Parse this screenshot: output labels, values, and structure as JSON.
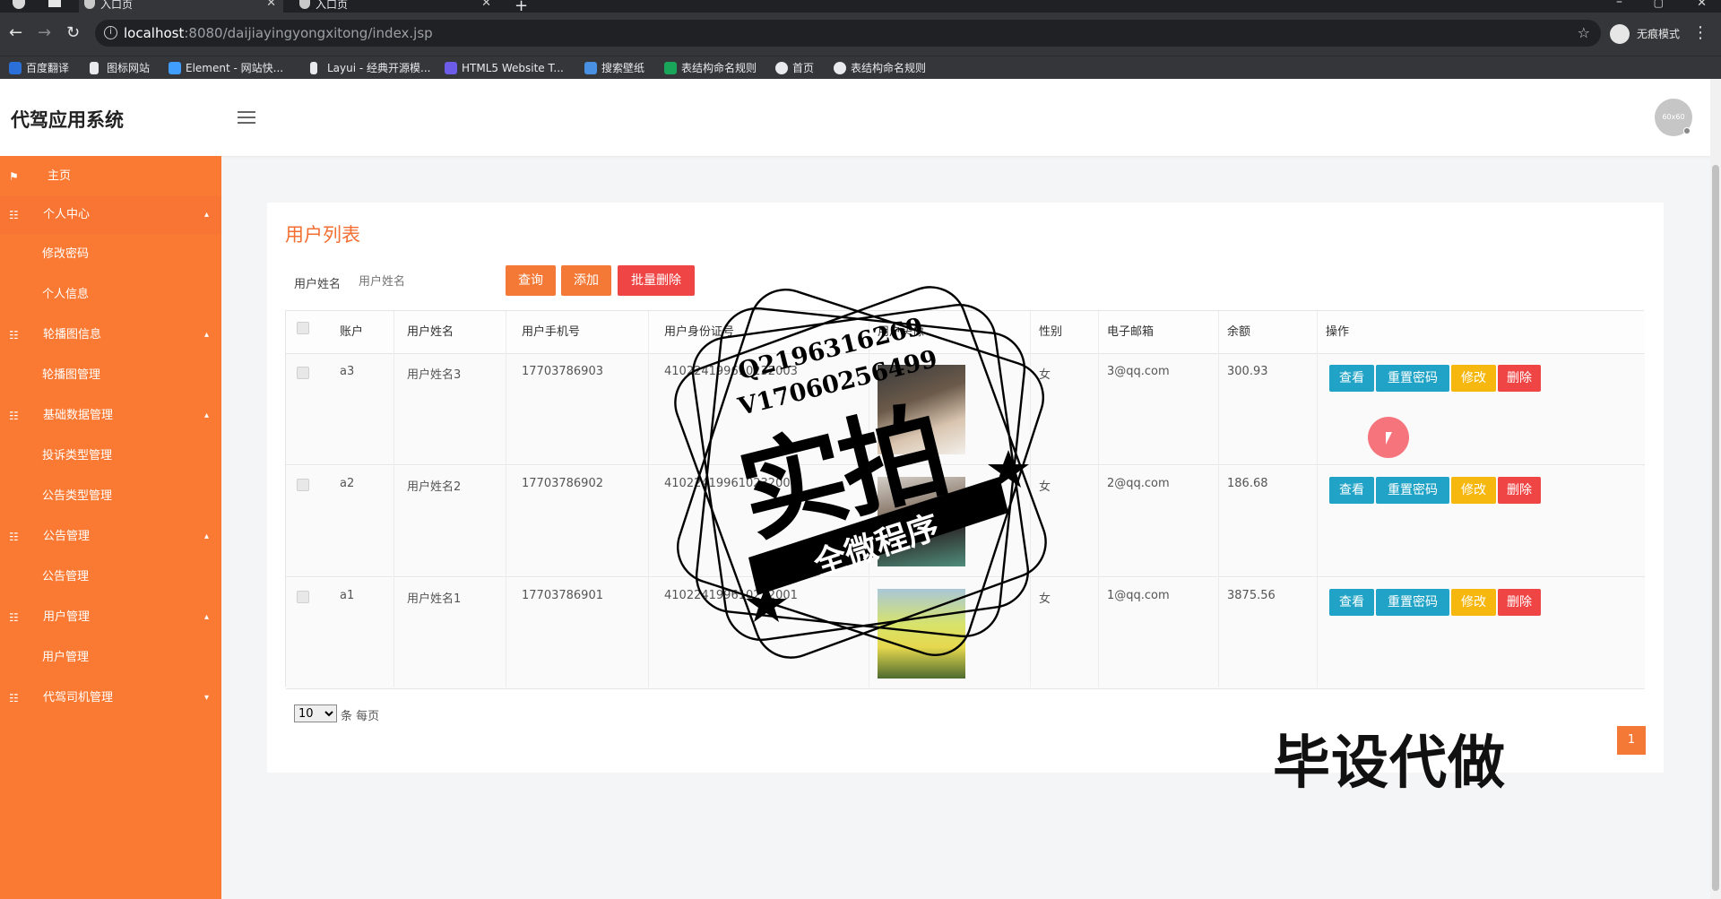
{
  "browser": {
    "tabs": [
      {
        "title": "入口页"
      },
      {
        "title": "入口页"
      }
    ],
    "url_host": "localhost",
    "url_path": ":8080/daijiayingyongxitong/index.jsp",
    "incognito_label": "无痕模式",
    "bookmarks": [
      {
        "label": "百度翻译",
        "color": "#2b6fd8"
      },
      {
        "label": "图标网站",
        "color": "#e8eaed"
      },
      {
        "label": "Element - 网站快...",
        "color": "#409eff"
      },
      {
        "label": "Layui - 经典开源模...",
        "color": "#e8eaed"
      },
      {
        "label": "HTML5 Website T...",
        "color": "#6c5ce7"
      },
      {
        "label": "搜索壁纸",
        "color": "#4a90e2"
      },
      {
        "label": "表结构命名规则",
        "color": "#19a55a"
      },
      {
        "label": "首页",
        "color": "#e8eaed"
      },
      {
        "label": "表结构命名规则",
        "color": "#e8eaed"
      }
    ]
  },
  "app": {
    "title": "代驾应用系统",
    "avatar_text": "60x60"
  },
  "sidebar": {
    "home": "主页",
    "groups": [
      {
        "label": "个人中心",
        "items": [
          "修改密码",
          "个人信息"
        ]
      },
      {
        "label": "轮播图信息",
        "items": [
          "轮播图管理"
        ]
      },
      {
        "label": "基础数据管理",
        "items": [
          "投诉类型管理",
          "公告类型管理"
        ]
      },
      {
        "label": "公告管理",
        "items": [
          "公告管理"
        ]
      },
      {
        "label": "用户管理",
        "items": [
          "用户管理"
        ]
      },
      {
        "label": "代驾司机管理",
        "items": []
      }
    ]
  },
  "main": {
    "title": "用户列表",
    "search_label": "用户姓名",
    "search_placeholder": "用户姓名",
    "buttons": {
      "query": "查询",
      "add": "添加",
      "batch_delete": "批量删除"
    },
    "columns": [
      "账户",
      "用户姓名",
      "用户手机号",
      "用户身份证号",
      "用户头像",
      "性别",
      "电子邮箱",
      "余额",
      "操作"
    ],
    "rows": [
      {
        "account": "a3",
        "name": "用户姓名3",
        "phone": "17703786903",
        "id_card": "410224199610232003",
        "gender": "女",
        "email": "3@qq.com",
        "balance": "300.93"
      },
      {
        "account": "a2",
        "name": "用户姓名2",
        "phone": "17703786902",
        "id_card": "410224199610232002",
        "gender": "女",
        "email": "2@qq.com",
        "balance": "186.68"
      },
      {
        "account": "a1",
        "name": "用户姓名1",
        "phone": "17703786901",
        "id_card": "410224199610232001",
        "gender": "女",
        "email": "1@qq.com",
        "balance": "3875.56"
      }
    ],
    "actions": {
      "view": "查看",
      "reset": "重置密码",
      "edit": "修改",
      "delete": "删除"
    },
    "page_size": "10",
    "page_size_label": "条 每页",
    "current_page": "1"
  },
  "watermark": {
    "qq": "Q2196316269",
    "vx": "V17060256499",
    "big": "实拍",
    "banner": "全微程序",
    "bottom": "毕设代做"
  }
}
